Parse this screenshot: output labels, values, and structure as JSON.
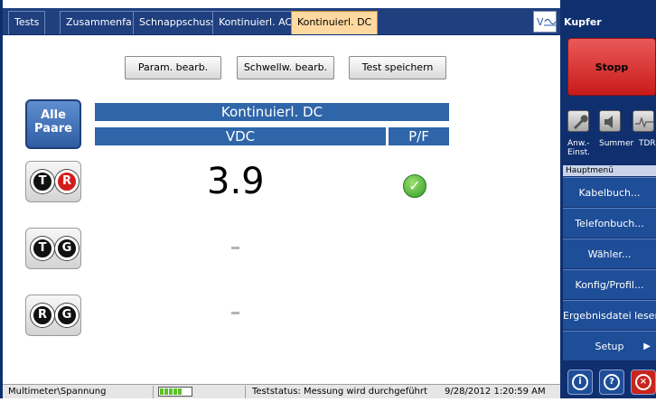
{
  "tabs": [
    {
      "label": "Tests"
    },
    {
      "label": "Zusammenfa."
    },
    {
      "label": "Schnappschuss"
    },
    {
      "label": "Kontinuierl. AC"
    },
    {
      "label": "Kontinuierl. DC"
    }
  ],
  "logo_icon": "viavi-logo-icon",
  "toolbar": {
    "param_label": "Param. bearb.",
    "schwell_label": "Schwellw. bearb.",
    "save_label": "Test speichern"
  },
  "alle_paare": {
    "line1": "Alle",
    "line2": "Paare"
  },
  "headers": {
    "title": "Kontinuierl. DC",
    "col_value": "VDC",
    "col_pf": "P/F"
  },
  "rows": [
    {
      "left": "T",
      "right": "R",
      "value": "3.9",
      "pass": "check-icon"
    },
    {
      "left": "T",
      "right": "G",
      "value": "–"
    },
    {
      "left": "R",
      "right": "G",
      "value": "–"
    }
  ],
  "status": {
    "mode": "Multimeter\\Spannung",
    "teststatus": "Teststatus: Messung wird durchgeführt",
    "datetime": "9/28/2012 1:20:59 AM"
  },
  "sidebar": {
    "title": "Kupfer",
    "stop_label": "Stopp",
    "icons": [
      {
        "name": "wrench-icon",
        "label1": "Anw.-",
        "label2": "Einst."
      },
      {
        "name": "speaker-icon",
        "label1": "Summer",
        "label2": ""
      },
      {
        "name": "tdr-icon",
        "label1": "TDR",
        "label2": ""
      }
    ],
    "menu_title": "Hauptmenü",
    "menu": [
      {
        "label": "Kabelbuch..."
      },
      {
        "label": "Telefonbuch..."
      },
      {
        "label": "Wähler..."
      },
      {
        "label": "Konfig/Profil..."
      },
      {
        "label": "Ergebnisdatei lesen"
      },
      {
        "label": "Setup"
      }
    ]
  },
  "colors": {
    "accent": "#2f65a9",
    "sidebar": "#0f2f6e",
    "stop": "#d52626",
    "active_tab": "#ffd9a0"
  }
}
